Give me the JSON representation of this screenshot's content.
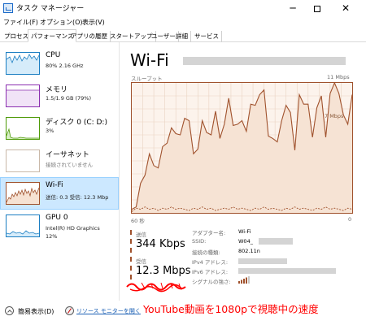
{
  "window": {
    "title": "タスク マネージャー",
    "minimize_glyph": "─",
    "close_glyph": "✕"
  },
  "menu": {
    "file": "ファイル(F)",
    "options": "オプション(O)",
    "view": "表示(V)"
  },
  "tabs": [
    {
      "label": "プロセス",
      "active": false
    },
    {
      "label": "パフォーマンス",
      "active": true
    },
    {
      "label": "アプリの履歴",
      "active": false
    },
    {
      "label": "スタートアップ",
      "active": false
    },
    {
      "label": "ユーザー",
      "active": false
    },
    {
      "label": "詳細",
      "active": false
    },
    {
      "label": "サービス",
      "active": false
    }
  ],
  "sidebar": {
    "cpu": {
      "name": "CPU",
      "detail": "80% 2.16 GHz",
      "color": "#1b7ec2"
    },
    "memory": {
      "name": "メモリ",
      "detail": "1.5/1.9 GB (79%)",
      "color": "#8b2fb0"
    },
    "disk": {
      "name": "ディスク 0 (C: D:)",
      "detail": "3%",
      "color": "#4d9a06"
    },
    "ethernet": {
      "name": "イーサネット",
      "detail": "接続されていません",
      "color": "#a0522d"
    },
    "wifi": {
      "name": "Wi-Fi",
      "detail": "送信: 0.3 受信: 12.3 Mbp",
      "color": "#a0522d"
    },
    "gpu": {
      "name": "GPU 0",
      "detail": "Intel(R) HD Graphics",
      "detail2": "12%",
      "color": "#1b7ec2"
    }
  },
  "main": {
    "title": "Wi-Fi",
    "throughput_label": "スループット",
    "max_label": "11 Mbps",
    "mid_label": "7 Mbps",
    "time_label": "60 秒",
    "zero_label": "0",
    "send_label": "送信",
    "send_value": "344 Kbps",
    "receive_label": "受信",
    "receive_value": "12.3 Mbps",
    "details": [
      {
        "label": "アダプター名:",
        "value": "Wi-Fi"
      },
      {
        "label": "SSID:",
        "value": "W04_"
      },
      {
        "label": "接続の種類:",
        "value": "802.11n"
      },
      {
        "label": "IPv4 アドレス:",
        "value": ""
      },
      {
        "label": "IPv6 アドレス:",
        "value": ""
      },
      {
        "label": "シグナルの強さ:",
        "value": ""
      }
    ]
  },
  "footer": {
    "fewer_details": "簡易表示(D)",
    "resource_monitor": "リソース モニターを開く"
  },
  "annotation": {
    "text": "YouTube動画を1080pで視聴中の速度",
    "color": "#ff0000"
  },
  "chart_data": {
    "type": "line",
    "ylim": [
      0,
      11
    ],
    "y_unit": "Mbps",
    "x_range_seconds": [
      60,
      0
    ],
    "series": [
      {
        "name": "受信",
        "values": [
          0.3,
          0.5,
          2.5,
          3.2,
          5.0,
          4.0,
          3.8,
          5.6,
          5.9,
          7.2,
          6.7,
          6.6,
          8.0,
          7.8,
          5.0,
          5.4,
          7.8,
          6.8,
          6.6,
          8.6,
          6.3,
          7.5,
          9.7,
          7.4,
          7.5,
          7.8,
          6.9,
          9.2,
          9.1,
          10.0,
          10.4,
          6.5,
          6.3,
          6.0,
          7.8,
          9.1,
          8.5,
          5.3,
          10.0,
          9.2,
          9.2,
          6.4,
          8.9,
          9.9,
          6.4,
          10.1,
          11.0,
          10.1,
          8.3,
          7.5,
          10.0
        ]
      },
      {
        "name": "送信",
        "values": [
          0.1,
          0.4,
          0.3,
          0.5,
          0.3,
          0.4,
          0.2,
          0.4,
          0.3,
          0.5,
          0.3,
          0.4,
          0.3,
          0.2,
          0.4,
          0.3,
          0.5,
          0.3,
          0.4,
          0.2,
          0.3,
          0.4,
          0.3,
          0.5,
          0.3,
          0.4,
          0.3,
          0.2,
          0.4,
          0.3,
          0.5,
          0.3,
          0.4,
          0.3,
          0.2,
          0.4,
          0.3,
          0.5,
          0.3,
          0.4,
          0.3,
          0.2,
          0.4,
          0.3,
          0.5,
          0.3,
          0.4,
          0.3,
          0.2,
          0.4,
          0.3
        ]
      }
    ]
  }
}
